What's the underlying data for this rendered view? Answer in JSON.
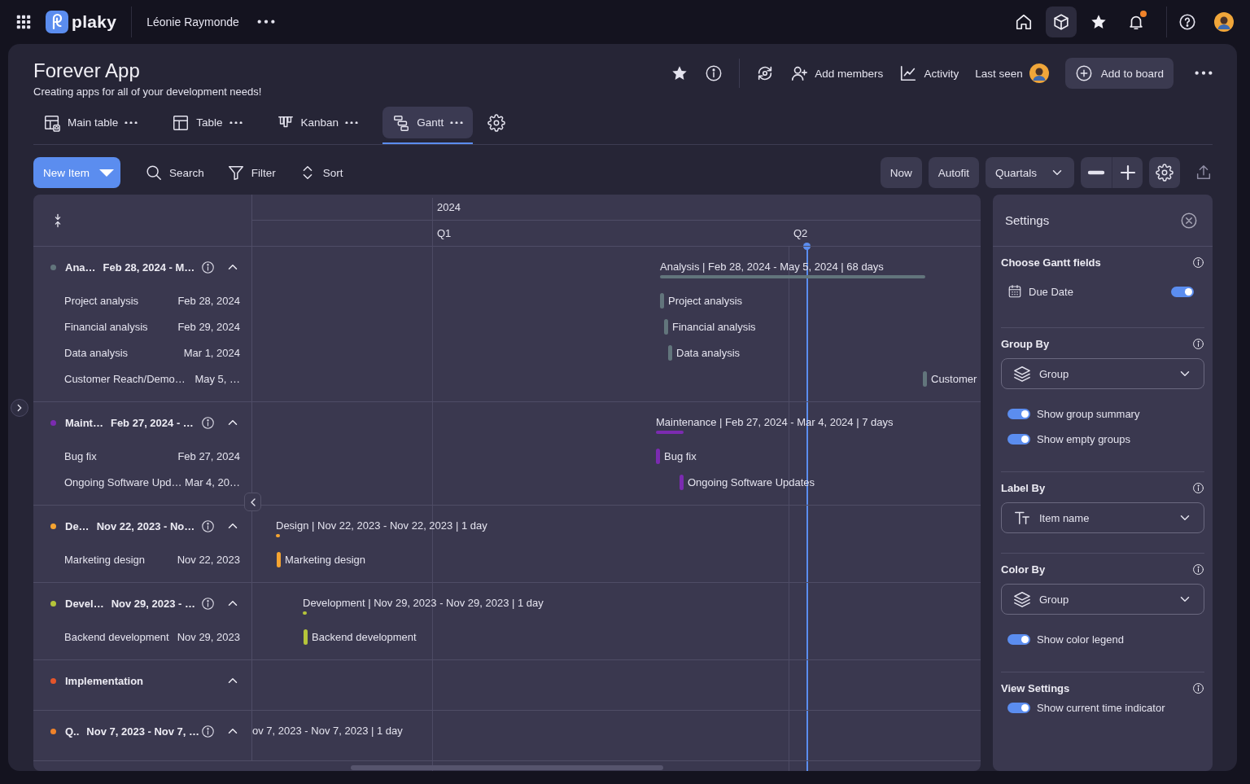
{
  "topbar": {
    "logo": "plaky",
    "workspace": "Léonie Raymonde",
    "nav": [
      {
        "selected": false,
        "unread": false
      },
      {
        "selected": true,
        "unread": false
      },
      {
        "selected": false,
        "unread": false
      },
      {
        "selected": false,
        "unread": true
      }
    ]
  },
  "board": {
    "title": "Forever App",
    "description": "Creating apps for all of your development needs!",
    "actions": [
      "Add members",
      "Activity",
      "Last seen"
    ],
    "add_button": "Add to board"
  },
  "views": [
    {
      "label": "Main table",
      "selected": false
    },
    {
      "label": "Table",
      "selected": false
    },
    {
      "label": "Kanban",
      "selected": false
    },
    {
      "label": "Gantt",
      "selected": true
    }
  ],
  "toolbar": {
    "new_item": "New Item",
    "tools": [
      "Search",
      "Filter",
      "Sort"
    ],
    "now": "Now",
    "autofit": "Autofit",
    "scale": "Quartals"
  },
  "timeline": {
    "year": "2024",
    "quarters": [
      "Q1",
      "Q2"
    ]
  },
  "groups": [
    {
      "name": "Ana…",
      "dates": "Feb 28, 2024 - M…",
      "color": "#62757c",
      "expanded": true,
      "summary": "Analysis | Feb 28, 2024 - May 5, 2024 | 68 days",
      "items": [
        {
          "name": "Project analysis",
          "date": "Feb 28, 2024",
          "bar_label": "Project analysis"
        },
        {
          "name": "Financial analysis",
          "date": "Feb 29, 2024",
          "bar_label": "Financial analysis"
        },
        {
          "name": "Data analysis",
          "date": "Mar 1, 2024",
          "bar_label": "Data analysis"
        },
        {
          "name": "Customer Reach/Demo…",
          "date": "May 5, …",
          "bar_label": "Customer"
        }
      ]
    },
    {
      "name": "Maint…",
      "dates": "Feb 27, 2024 - …",
      "color": "#7b2bb0",
      "expanded": true,
      "summary": "Maintenance | Feb 27, 2024 - Mar 4, 2024 | 7 days",
      "items": [
        {
          "name": "Bug fix",
          "date": "Feb 27, 2024",
          "bar_label": "Bug fix"
        },
        {
          "name": "Ongoing Software Upd…",
          "date": "Mar 4, 20…",
          "bar_label": "Ongoing Software Updates"
        }
      ]
    },
    {
      "name": "De…",
      "dates": "Nov 22, 2023 - No…",
      "color": "#f5a431",
      "expanded": true,
      "summary": "Design | Nov 22, 2023 - Nov 22, 2023 | 1 day",
      "items": [
        {
          "name": "Marketing design",
          "date": "Nov 22, 2023",
          "bar_label": "Marketing design"
        }
      ]
    },
    {
      "name": "Devel…",
      "dates": "Nov 29, 2023 - …",
      "color": "#b5c53a",
      "expanded": true,
      "summary": "Development | Nov 29, 2023 - Nov 29, 2023 | 1 day",
      "items": [
        {
          "name": "Backend development",
          "date": "Nov 29, 2023",
          "bar_label": "Backend development"
        }
      ]
    },
    {
      "name": "Implementation",
      "color": "#e5552b",
      "expanded": true
    },
    {
      "name": "Q..",
      "dates": "Nov 7, 2023 - Nov 7, …",
      "color": "#f0832a",
      "expanded": true,
      "summary": "ov 7, 2023 - Nov 7, 2023 | 1 day"
    }
  ],
  "settings": {
    "title": "Settings",
    "sections": [
      {
        "title": "Choose Gantt fields",
        "controls": [
          {
            "kind": "field",
            "label": "Due Date",
            "on": true
          }
        ]
      },
      {
        "title": "Group By",
        "controls": [
          {
            "kind": "layer-select",
            "value": "Group"
          },
          {
            "kind": "toggle",
            "label": "Show group summary",
            "on": true
          },
          {
            "kind": "toggle",
            "label": "Show empty groups",
            "on": true
          }
        ]
      },
      {
        "title": "Label By",
        "controls": [
          {
            "kind": "text-select",
            "value": "Item name"
          }
        ]
      },
      {
        "title": "Color By",
        "controls": [
          {
            "kind": "layer-select",
            "value": "Group"
          },
          {
            "kind": "toggle",
            "label": "Show color legend",
            "on": true
          }
        ]
      },
      {
        "title": "View Settings",
        "controls": [
          {
            "kind": "toggle",
            "label": "Show current time indicator",
            "on": true
          }
        ]
      }
    ]
  }
}
